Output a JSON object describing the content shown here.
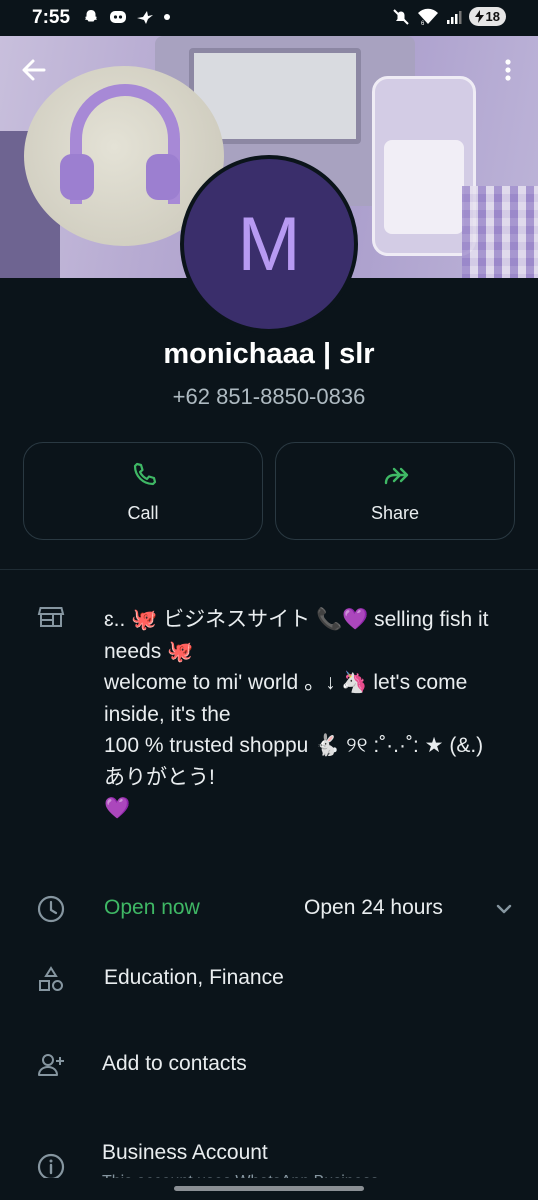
{
  "status_bar": {
    "time": "7:55",
    "left_icons": [
      "snapchat-icon",
      "discord-icon",
      "bird-icon",
      "dot-icon"
    ],
    "right_icons": [
      "mute-icon",
      "wifi-icon",
      "signal-icon"
    ],
    "battery": "18"
  },
  "profile": {
    "avatar_initial": "M",
    "name": "monichaaa | slr",
    "phone": "+62 851-8850-0836"
  },
  "actions": {
    "call_label": "Call",
    "share_label": "Share"
  },
  "about": {
    "text": "ɛ.. 🐙 ビジネスサイト 📞💜 selling fish it needs  🐙\nwelcome to mi' world 。↓ 🦄  let's come inside, it's the\n100 % trusted shoppu  🐇  ୨୧ :˚·.·˚: ★ (&.)\nありがとう!\n💜"
  },
  "hours": {
    "status": "Open now",
    "detail": "Open 24 hours"
  },
  "category": "Education, Finance",
  "add_contact_label": "Add to contacts",
  "business": {
    "title": "Business Account",
    "subtitle": "This account uses WhatsApp Business"
  },
  "colors": {
    "background": "#0b141a",
    "accent_green": "#3fb865",
    "avatar_bg": "#3a2e6b",
    "avatar_letter": "#b79af2"
  }
}
